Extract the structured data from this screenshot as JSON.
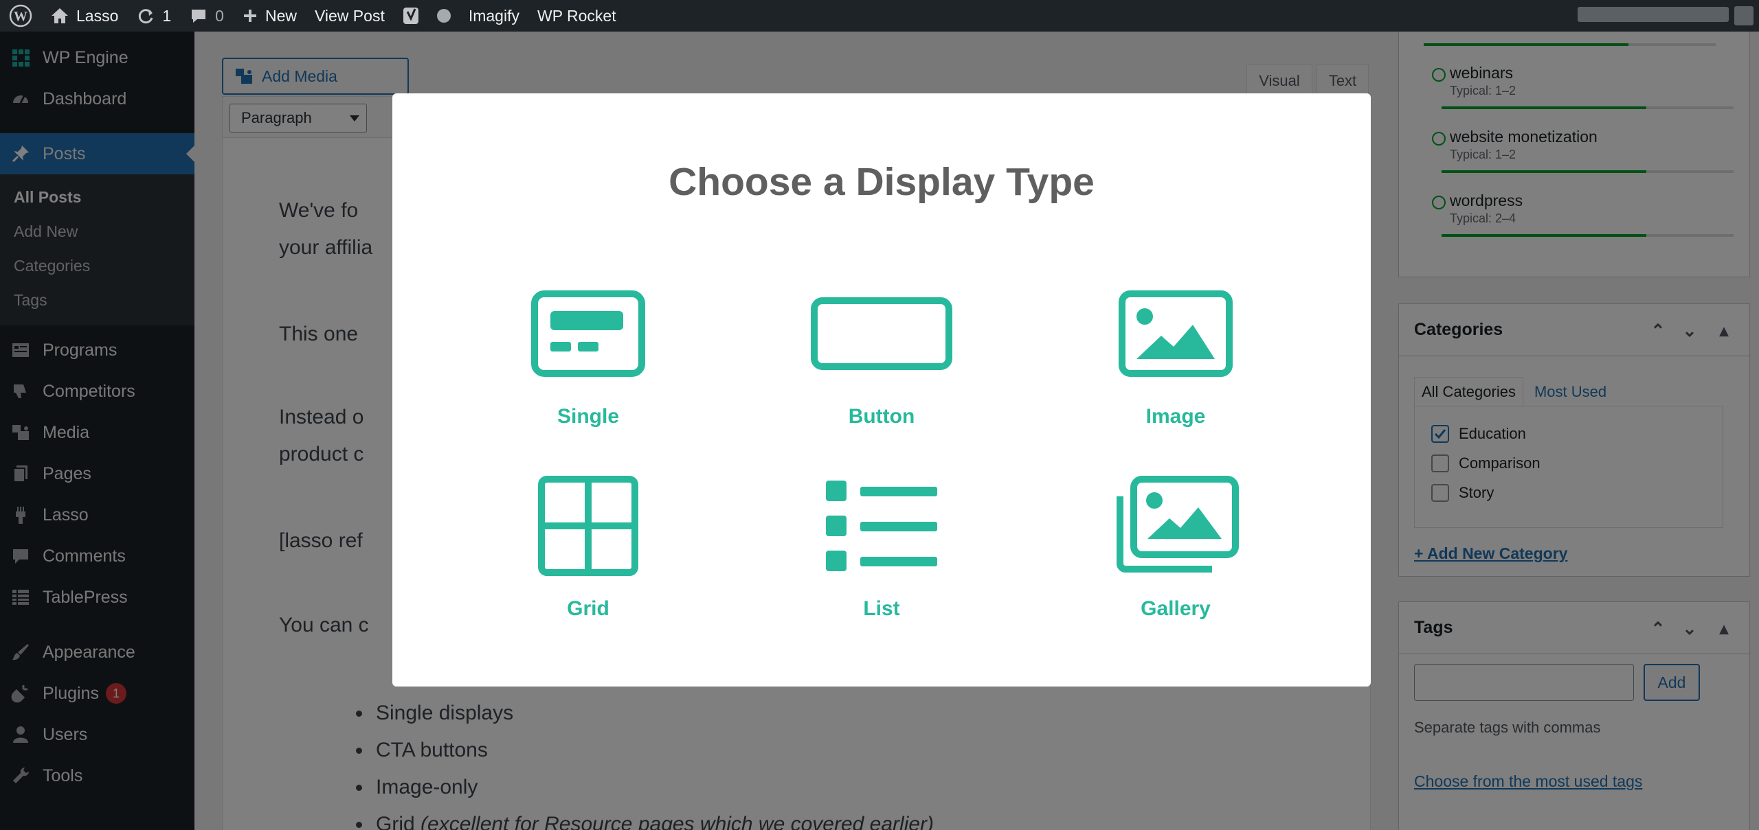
{
  "adminbar": {
    "site_name": "Lasso",
    "updates_count": "1",
    "comments_count": "0",
    "new_label": "New",
    "view_post_label": "View Post",
    "imagify_label": "Imagify",
    "rocket_label": "WP Rocket"
  },
  "sidebar": {
    "items_top": [
      {
        "label": "WP Engine",
        "icon": "wp-engine-icon"
      },
      {
        "label": "Dashboard",
        "icon": "dashboard-icon"
      }
    ],
    "current": {
      "label": "Posts",
      "icon": "pushpin-icon"
    },
    "submenu": [
      "All Posts",
      "Add New",
      "Categories",
      "Tags"
    ],
    "items_mid": [
      {
        "label": "Programs",
        "icon": "programs-icon"
      },
      {
        "label": "Competitors",
        "icon": "thumbs-down-icon"
      },
      {
        "label": "Media",
        "icon": "media-icon"
      },
      {
        "label": "Pages",
        "icon": "pages-icon"
      },
      {
        "label": "Lasso",
        "icon": "lasso-icon"
      },
      {
        "label": "Comments",
        "icon": "comment-icon"
      },
      {
        "label": "TablePress",
        "icon": "table-icon"
      }
    ],
    "items_bottom": [
      {
        "label": "Appearance",
        "icon": "brush-icon"
      },
      {
        "label": "Plugins",
        "icon": "plug-icon",
        "badge": "1"
      },
      {
        "label": "Users",
        "icon": "user-icon"
      },
      {
        "label": "Tools",
        "icon": "wrench-icon"
      }
    ]
  },
  "editor": {
    "add_media": "Add Media",
    "tab_visual": "Visual",
    "tab_text": "Text",
    "format_select": "Paragraph",
    "lines": [
      "We've fo",
      "your affilia",
      "This one",
      "Instead o",
      "product c",
      "[lasso ref",
      "You can c"
    ],
    "bullets": [
      "Single displays",
      "CTA buttons",
      "Image-only"
    ],
    "last_bullet": {
      "start": "Grid ",
      "italic": "(excellent for ",
      "bold": "Resource pages",
      "end": " which we covered earlier)"
    }
  },
  "tags_list": [
    {
      "name": "webinars",
      "typical": "Typical: 1–2",
      "progress": 0.7
    },
    {
      "name": "website monetization",
      "typical": "Typical: 1–2",
      "progress": 0.7
    },
    {
      "name": "wordpress",
      "typical": "Typical: 2–4",
      "progress": 0.7
    }
  ],
  "categories": {
    "title": "Categories",
    "tab_all": "All Categories",
    "tab_used": "Most Used",
    "items": [
      {
        "label": "Education",
        "checked": true
      },
      {
        "label": "Comparison",
        "checked": false
      },
      {
        "label": "Story",
        "checked": false
      }
    ],
    "add_new": "+ Add New Category"
  },
  "tags": {
    "title": "Tags",
    "add_button": "Add",
    "hint": "Separate tags with commas",
    "choose_link": "Choose from the most used tags"
  },
  "modal": {
    "title": "Choose a Display Type",
    "accent": "#28b99c",
    "options": [
      {
        "label": "Single",
        "icon": "single-display-icon"
      },
      {
        "label": "Button",
        "icon": "button-display-icon"
      },
      {
        "label": "Image",
        "icon": "image-display-icon"
      },
      {
        "label": "Grid",
        "icon": "grid-display-icon"
      },
      {
        "label": "List",
        "icon": "list-display-icon"
      },
      {
        "label": "Gallery",
        "icon": "gallery-display-icon"
      }
    ]
  }
}
